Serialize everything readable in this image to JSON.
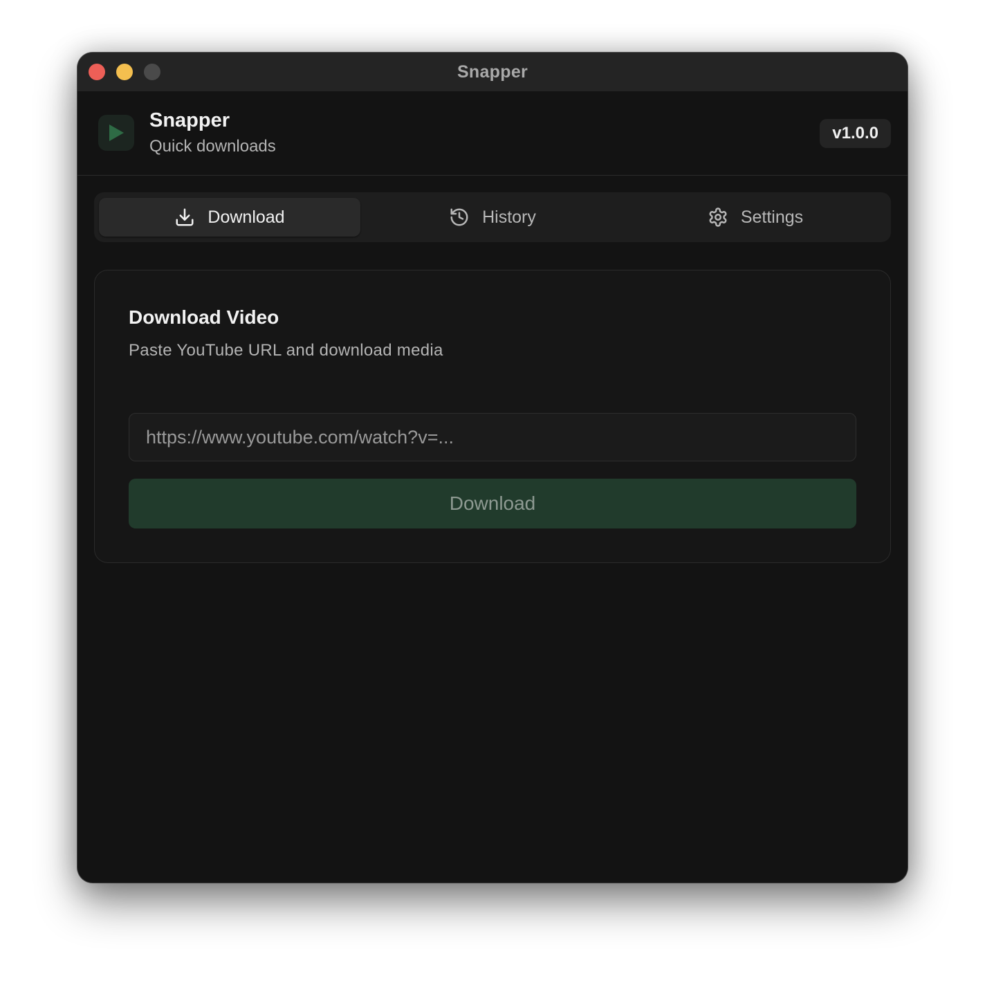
{
  "window": {
    "title": "Snapper",
    "traffic_lights": {
      "close_color": "#ed5f57",
      "minimize_color": "#f4bf4f",
      "maximize_color": "#4a4a4a"
    }
  },
  "header": {
    "app_name": "Snapper",
    "tagline": "Quick downloads",
    "version": "v1.0.0",
    "logo_icon": "play-icon",
    "accent_color": "#2e6b45"
  },
  "tabs": [
    {
      "label": "Download",
      "icon": "download-icon",
      "active": true
    },
    {
      "label": "History",
      "icon": "history-icon",
      "active": false
    },
    {
      "label": "Settings",
      "icon": "gear-icon",
      "active": false
    }
  ],
  "download_card": {
    "title": "Download Video",
    "subtitle": "Paste YouTube URL and download media",
    "url_placeholder": "https://www.youtube.com/watch?v=...",
    "url_value": "",
    "button_label": "Download",
    "button_color": "#213b2c",
    "button_enabled": false
  }
}
